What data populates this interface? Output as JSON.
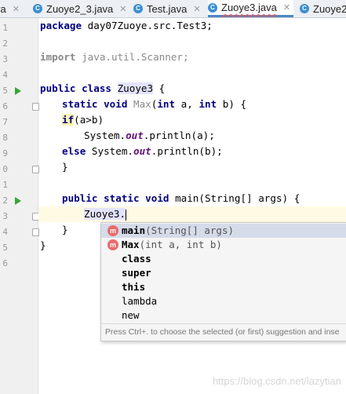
{
  "tabs": [
    {
      "label": "va",
      "icon": "java-class-icon",
      "active": false,
      "closable": true
    },
    {
      "label": "Zuoye2_3.java",
      "icon": "java-class-icon",
      "active": false,
      "closable": true
    },
    {
      "label": "Test.java",
      "icon": "java-class-icon",
      "active": false,
      "closable": true
    },
    {
      "label": "Zuoye3.java",
      "icon": "java-class-icon",
      "active": true,
      "closable": true
    },
    {
      "label": "Zuoye2",
      "icon": "java-class-icon",
      "active": false,
      "closable": false
    }
  ],
  "gutter": {
    "line_numbers": [
      "1",
      "2",
      "3",
      "4",
      "5",
      "6",
      "7",
      "8",
      "9",
      "0",
      "1",
      "2",
      "3",
      "4",
      "5",
      "6"
    ]
  },
  "code": {
    "l1_kw": "package",
    "l1_rest": " day07Zuoye.src.Test3;",
    "l3_kw": "import",
    "l3_rest": " java.util.Scanner;",
    "l5_kw": "public class ",
    "l5_name": "Zuoye3",
    "l5_rest": " {",
    "l6_kw": "static void ",
    "l6_name": "Max",
    "l6_a": "(",
    "l6_int1": "int",
    "l6_b": " a, ",
    "l6_int2": "int",
    "l6_c": " b) {",
    "l7_kw": "if",
    "l7_rest": "(a>b)",
    "l8_pre": "System.",
    "l8_out": "out",
    "l8_rest": ".println(a);",
    "l9_kw": "else ",
    "l9_pre": "System.",
    "l9_out": "out",
    "l9_rest": ".println(b);",
    "l10": "}",
    "l12_kw": "public static void ",
    "l12_rest": "main(String[] args) {",
    "l13": "Zuoye3.",
    "l14": "}",
    "l15": "}"
  },
  "completion": {
    "items": [
      {
        "icon": "m",
        "name": "main",
        "params": "(String[] args)"
      },
      {
        "icon": "m",
        "name": "Max",
        "params": "(int a, int b)"
      },
      {
        "icon": "",
        "name": "class",
        "params": ""
      },
      {
        "icon": "",
        "name": "super",
        "params": ""
      },
      {
        "icon": "",
        "name": "this",
        "params": ""
      },
      {
        "icon": "",
        "name": "lambda",
        "params": ""
      },
      {
        "icon": "",
        "name": "new",
        "params": ""
      }
    ],
    "hint": "Press Ctrl+. to choose the selected (or first) suggestion and inse"
  },
  "watermark": "https://blog.csdn.net/lazytian",
  "colors": {
    "keyword": "#000080",
    "method_icon": "#e86b6b",
    "active_tab_underline": "#4a88c7",
    "caret_line": "#fffae3",
    "run_icon": "#3aa33a"
  }
}
